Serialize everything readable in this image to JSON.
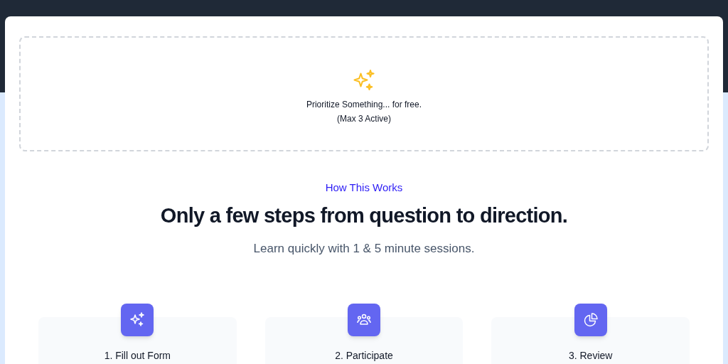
{
  "upload_area": {
    "title": "Prioritize Something... for free.",
    "note": "(Max 3 Active)"
  },
  "section": {
    "eyebrow": "How This Works",
    "heading": "Only a few steps from question to direction.",
    "subheading": "Learn quickly with 1 & 5 minute sessions."
  },
  "steps": [
    {
      "kind": "sparkles",
      "title": "1. Fill out Form"
    },
    {
      "kind": "users",
      "title": "2. Participate"
    },
    {
      "kind": "chart",
      "title": "3. Review"
    }
  ]
}
